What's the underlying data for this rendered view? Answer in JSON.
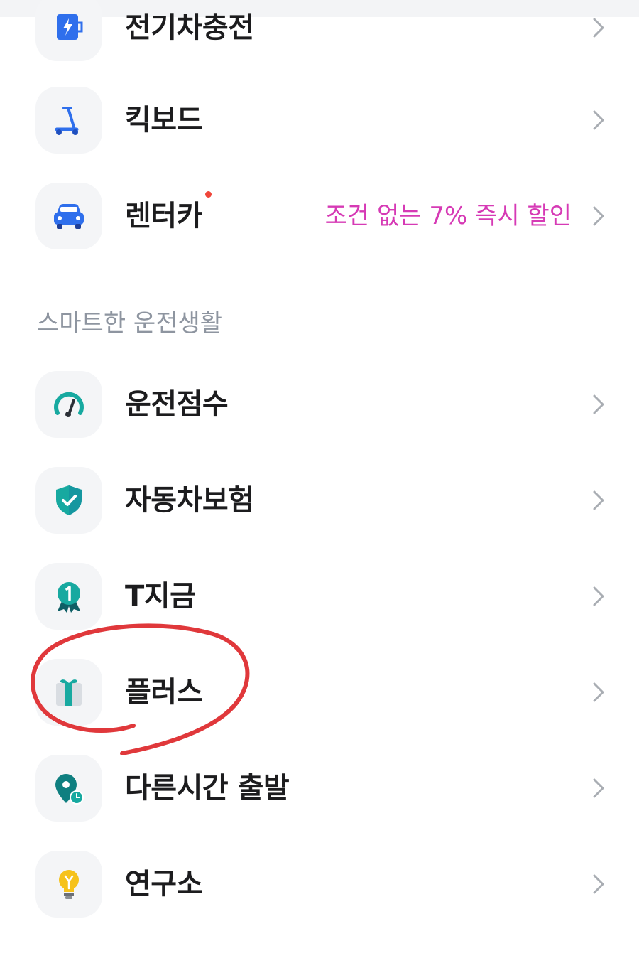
{
  "menu_top": [
    {
      "id": "ev-charging",
      "label": "전기차충전",
      "icon": "ev-charger-icon"
    },
    {
      "id": "kickboard",
      "label": "킥보드",
      "icon": "kickboard-icon"
    },
    {
      "id": "rentacar",
      "label": "렌터카",
      "icon": "car-icon",
      "promo": "조건 없는 7% 즉시 할인",
      "has_new_dot": true
    }
  ],
  "section": {
    "title": "스마트한 운전생활"
  },
  "menu_smart": [
    {
      "id": "driving-score",
      "label": "운전점수",
      "icon": "speedometer-icon"
    },
    {
      "id": "car-insurance",
      "label": "자동차보험",
      "icon": "shield-check-icon"
    },
    {
      "id": "t-now",
      "label": "T지금",
      "icon": "badge-number-one-icon"
    },
    {
      "id": "plus",
      "label": "플러스",
      "icon": "gift-icon"
    },
    {
      "id": "other-time-departure",
      "label": "다른시간 출발",
      "icon": "location-clock-icon"
    },
    {
      "id": "lab",
      "label": "연구소",
      "icon": "lightbulb-icon"
    }
  ],
  "colors": {
    "accent_blue": "#2f6fec",
    "accent_teal": "#17a9a0",
    "promo_pink": "#d63ab5",
    "new_dot": "#f0463a",
    "annotation_red": "#e0383b",
    "chevron": "#a9adb3"
  }
}
